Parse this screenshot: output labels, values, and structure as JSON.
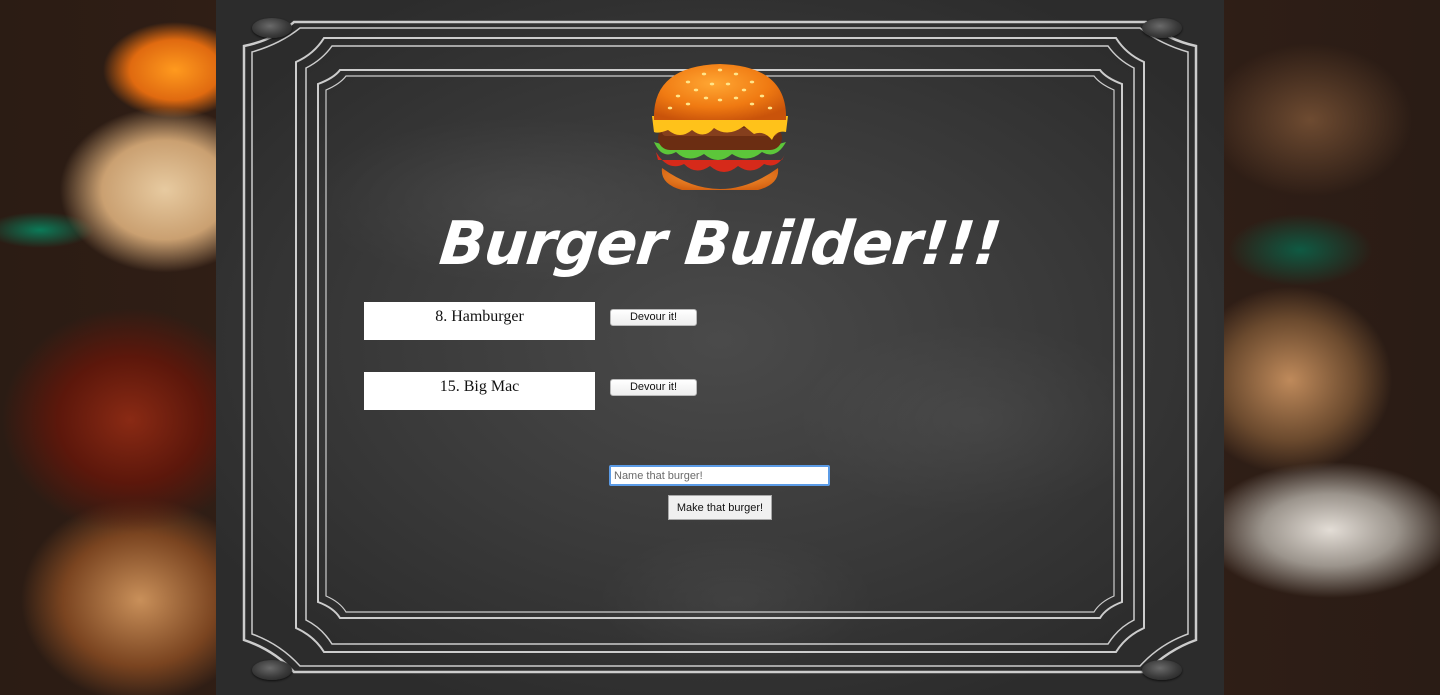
{
  "header": {
    "logo_icon": "hamburger-icon",
    "title": "Burger Builder!!!"
  },
  "burgers": [
    {
      "label": "8. Hamburger",
      "button_label": "Devour it!"
    },
    {
      "label": "15. Big Mac",
      "button_label": "Devour it!"
    }
  ],
  "form": {
    "placeholder": "Name that burger!",
    "submit_label": "Make that burger!"
  },
  "colors": {
    "chalkboard": "#3a3a3a",
    "chalk": "#ffffff",
    "input_focus": "#5b9be6"
  }
}
